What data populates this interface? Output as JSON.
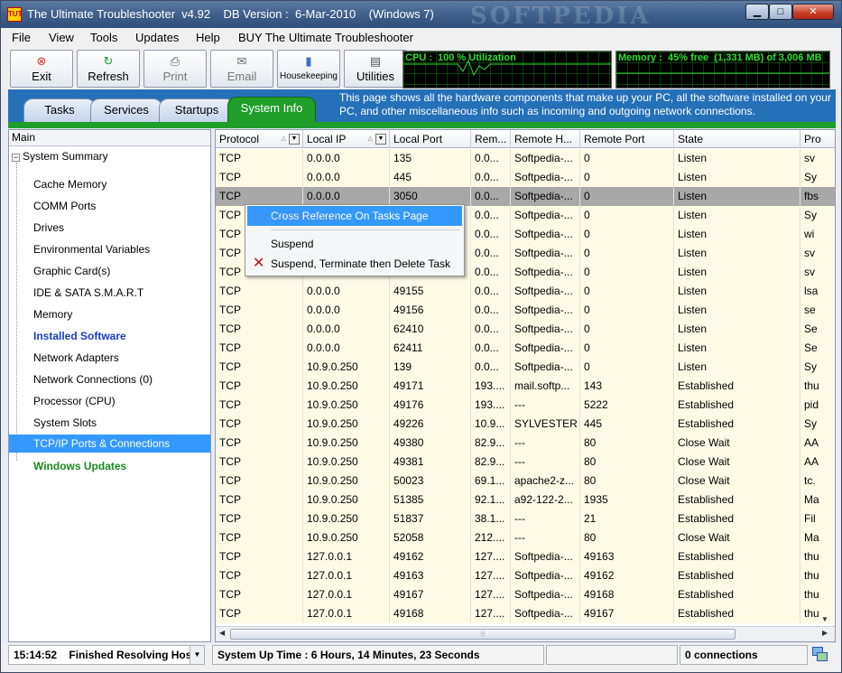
{
  "window": {
    "title": "The Ultimate Troubleshooter  v4.92    DB Version :  6-Mar-2010    (Windows 7)",
    "watermark": "SOFTPEDIA",
    "controls": {
      "minimize": "▁",
      "maximize": "□",
      "close": "✕"
    }
  },
  "menu": [
    {
      "label": "File"
    },
    {
      "label": "View"
    },
    {
      "label": "Tools"
    },
    {
      "label": "Updates"
    },
    {
      "label": "Help"
    },
    {
      "label": "BUY The Ultimate Troubleshooter"
    }
  ],
  "toolbar": {
    "buttons": [
      {
        "label": "Exit",
        "icon": "exit-icon",
        "glyph": "⊗",
        "color": "#e03a2f"
      },
      {
        "label": "Refresh",
        "icon": "refresh-icon",
        "glyph": "↻",
        "color": "#1c9a2a"
      },
      {
        "label": "Print",
        "icon": "printer-icon",
        "glyph": "⎙",
        "color": "#555555"
      },
      {
        "label": "Email",
        "icon": "email-icon",
        "glyph": "✉",
        "color": "#6a6a6a"
      },
      {
        "label": "Housekeeping",
        "icon": "housekeeping-icon",
        "glyph": "▮",
        "color": "#3b6fd4"
      },
      {
        "label": "Utilities",
        "icon": "utilities-icon",
        "glyph": "▤",
        "color": "#555555"
      }
    ],
    "cpu": {
      "label": "CPU :  100 % Utilization",
      "value": 100
    },
    "memory": {
      "label": "Memory :  45% free  (1,331 MB) of 3,006 MB",
      "free_percent": 45
    }
  },
  "tabs": {
    "items": [
      {
        "label": "Tasks",
        "active": false
      },
      {
        "label": "Services",
        "active": false
      },
      {
        "label": "Startups",
        "active": false
      },
      {
        "label": "System Info",
        "active": true
      }
    ],
    "description": "This page shows all the hardware components that make up your PC, all the software installed on your PC, and other miscellaneous info such as incoming and outgoing network connections.",
    "accent": "#1f9e2a"
  },
  "tree": {
    "header": "Main",
    "root": {
      "label": "System Summary",
      "expander": "−"
    },
    "items": [
      {
        "label": "Cache Memory",
        "style": "normal"
      },
      {
        "label": "COMM Ports",
        "style": "normal"
      },
      {
        "label": "Drives",
        "style": "normal"
      },
      {
        "label": "Environmental Variables",
        "style": "normal"
      },
      {
        "label": "Graphic Card(s)",
        "style": "normal"
      },
      {
        "label": "IDE & SATA S.M.A.R.T",
        "style": "normal"
      },
      {
        "label": "Memory",
        "style": "normal"
      },
      {
        "label": "Installed Software",
        "style": "blue"
      },
      {
        "label": "Network Adapters",
        "style": "normal"
      },
      {
        "label": "Network Connections (0)",
        "style": "normal"
      },
      {
        "label": "Processor (CPU)",
        "style": "normal"
      },
      {
        "label": "System Slots",
        "style": "normal"
      },
      {
        "label": "TCP/IP Ports & Connections",
        "style": "selected"
      },
      {
        "label": "Windows Updates",
        "style": "green"
      }
    ]
  },
  "grid": {
    "columns": [
      {
        "label": "Protocol",
        "filter": true
      },
      {
        "label": "Local IP",
        "filter": true
      },
      {
        "label": "Local Port",
        "filter": false
      },
      {
        "label": "Rem...",
        "filter": false
      },
      {
        "label": "Remote H...",
        "filter": false
      },
      {
        "label": "Remote Port",
        "filter": false
      },
      {
        "label": "State",
        "filter": false
      },
      {
        "label": "Pro",
        "filter": false
      }
    ],
    "rows": [
      [
        "TCP",
        "0.0.0.0",
        "135",
        "0.0...",
        "Softpedia-...",
        "0",
        "Listen",
        "sv"
      ],
      [
        "TCP",
        "0.0.0.0",
        "445",
        "0.0...",
        "Softpedia-...",
        "0",
        "Listen",
        "Sy"
      ],
      [
        "TCP",
        "0.0.0.0",
        "3050",
        "0.0...",
        "Softpedia-...",
        "0",
        "Listen",
        "fbs"
      ],
      [
        "TCP",
        "0.0.0.0",
        "",
        "0.0...",
        "Softpedia-...",
        "0",
        "Listen",
        "Sy"
      ],
      [
        "TCP",
        "0.0.0.0",
        "",
        "0.0...",
        "Softpedia-...",
        "0",
        "Listen",
        "wi"
      ],
      [
        "TCP",
        "0.0.0.0",
        "",
        "0.0...",
        "Softpedia-...",
        "0",
        "Listen",
        "sv"
      ],
      [
        "TCP",
        "0.0.0.0",
        "",
        "0.0...",
        "Softpedia-...",
        "0",
        "Listen",
        "sv"
      ],
      [
        "TCP",
        "0.0.0.0",
        "49155",
        "0.0...",
        "Softpedia-...",
        "0",
        "Listen",
        "lsa"
      ],
      [
        "TCP",
        "0.0.0.0",
        "49156",
        "0.0...",
        "Softpedia-...",
        "0",
        "Listen",
        "se"
      ],
      [
        "TCP",
        "0.0.0.0",
        "62410",
        "0.0...",
        "Softpedia-...",
        "0",
        "Listen",
        "Se"
      ],
      [
        "TCP",
        "0.0.0.0",
        "62411",
        "0.0...",
        "Softpedia-...",
        "0",
        "Listen",
        "Se"
      ],
      [
        "TCP",
        "10.9.0.250",
        "139",
        "0.0...",
        "Softpedia-...",
        "0",
        "Listen",
        "Sy"
      ],
      [
        "TCP",
        "10.9.0.250",
        "49171",
        "193....",
        "mail.softp...",
        "143",
        "Established",
        "thu"
      ],
      [
        "TCP",
        "10.9.0.250",
        "49176",
        "193....",
        "---",
        "5222",
        "Established",
        "pid"
      ],
      [
        "TCP",
        "10.9.0.250",
        "49226",
        "10.9...",
        "SYLVESTER",
        "445",
        "Established",
        "Sy"
      ],
      [
        "TCP",
        "10.9.0.250",
        "49380",
        "82.9...",
        "---",
        "80",
        "Close Wait",
        "AA"
      ],
      [
        "TCP",
        "10.9.0.250",
        "49381",
        "82.9...",
        "---",
        "80",
        "Close Wait",
        "AA"
      ],
      [
        "TCP",
        "10.9.0.250",
        "50023",
        "69.1...",
        "apache2-z...",
        "80",
        "Close Wait",
        "tc."
      ],
      [
        "TCP",
        "10.9.0.250",
        "51385",
        "92.1...",
        "a92-122-2...",
        "1935",
        "Established",
        "Ma"
      ],
      [
        "TCP",
        "10.9.0.250",
        "51837",
        "38.1...",
        "---",
        "21",
        "Established",
        "Fil"
      ],
      [
        "TCP",
        "10.9.0.250",
        "52058",
        "212....",
        "---",
        "80",
        "Close Wait",
        "Ma"
      ],
      [
        "TCP",
        "127.0.0.1",
        "49162",
        "127....",
        "Softpedia-...",
        "49163",
        "Established",
        "thu"
      ],
      [
        "TCP",
        "127.0.0.1",
        "49163",
        "127....",
        "Softpedia-...",
        "49162",
        "Established",
        "thu"
      ],
      [
        "TCP",
        "127.0.0.1",
        "49167",
        "127....",
        "Softpedia-...",
        "49168",
        "Established",
        "thu"
      ],
      [
        "TCP",
        "127.0.0.1",
        "49168",
        "127....",
        "Softpedia-...",
        "49167",
        "Established",
        "thu"
      ]
    ],
    "selected_row": 2,
    "hscroll_grip": "⦙⦙⦙"
  },
  "context_menu": {
    "items": [
      {
        "label": "Cross Reference On Tasks Page",
        "highlighted": true,
        "icon": ""
      },
      {
        "label": "Suspend",
        "highlighted": false,
        "icon": ""
      },
      {
        "label": "Suspend, Terminate then Delete Task",
        "highlighted": false,
        "icon": "delete-x-icon"
      }
    ]
  },
  "statusbar": {
    "time": "15:14:52",
    "status": "Finished Resolving Hos",
    "uptime": "System Up Time :  6 Hours, 14 Minutes, 23 Seconds",
    "connections": "0 connections"
  }
}
